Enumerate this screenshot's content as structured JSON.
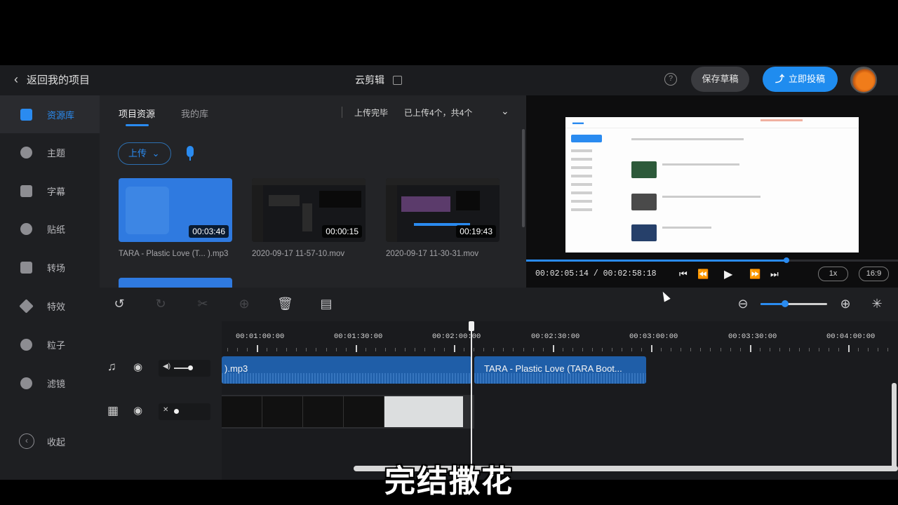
{
  "header": {
    "back_label": "返回我的项目",
    "app_title": "云剪辑",
    "help_icon": "?",
    "save_draft_label": "保存草稿",
    "publish_label": "立即投稿"
  },
  "sidebar": {
    "items": [
      {
        "label": "资源库",
        "icon": "folder-icon",
        "active": true
      },
      {
        "label": "主题",
        "icon": "theme-icon",
        "active": false
      },
      {
        "label": "字幕",
        "icon": "text-icon",
        "active": false
      },
      {
        "label": "贴纸",
        "icon": "sticker-icon",
        "active": false
      },
      {
        "label": "转场",
        "icon": "transition-icon",
        "active": false
      },
      {
        "label": "特效",
        "icon": "effects-icon",
        "active": false
      },
      {
        "label": "粒子",
        "icon": "particle-icon",
        "active": false
      },
      {
        "label": "滤镜",
        "icon": "filter-icon",
        "active": false
      }
    ],
    "collapse_label": "收起"
  },
  "assets": {
    "tabs": [
      "项目资源",
      "我的库"
    ],
    "upload_status": "上传完毕",
    "upload_count": "已上传4个，共4个",
    "upload_button": "上传",
    "files": [
      {
        "name": "TARA - Plastic Love (T... ).mp3",
        "duration": "00:03:46",
        "kind": "audio"
      },
      {
        "name": "2020-09-17 11-57-10.mov",
        "duration": "00:00:15",
        "kind": "video"
      },
      {
        "name": "2020-09-17 11-30-31.mov",
        "duration": "00:19:43",
        "kind": "video"
      }
    ]
  },
  "preview": {
    "current_time": "00:02:05:14",
    "total_time": "00:02:58:18",
    "timecode": "00:02:05:14 / 00:02:58:18",
    "speed": "1x",
    "aspect": "16:9",
    "progress": 0.7
  },
  "timeline": {
    "ruler": [
      "00:01:00:00",
      "00:01:30:00",
      "00:02:00:00",
      "00:02:30:00",
      "00:03:00:00",
      "00:03:30:00",
      "00:04:00:00"
    ],
    "audio_clip_1": ").mp3",
    "audio_clip_2": "TARA - Plastic Love (TARA Boot...",
    "volume_icon_label": "◀)",
    "zoom_level": 0.35
  },
  "caption": "完结撒花",
  "colors": {
    "accent": "#2a8bf0",
    "panel": "#232427",
    "clip": "#1f5ea8"
  }
}
